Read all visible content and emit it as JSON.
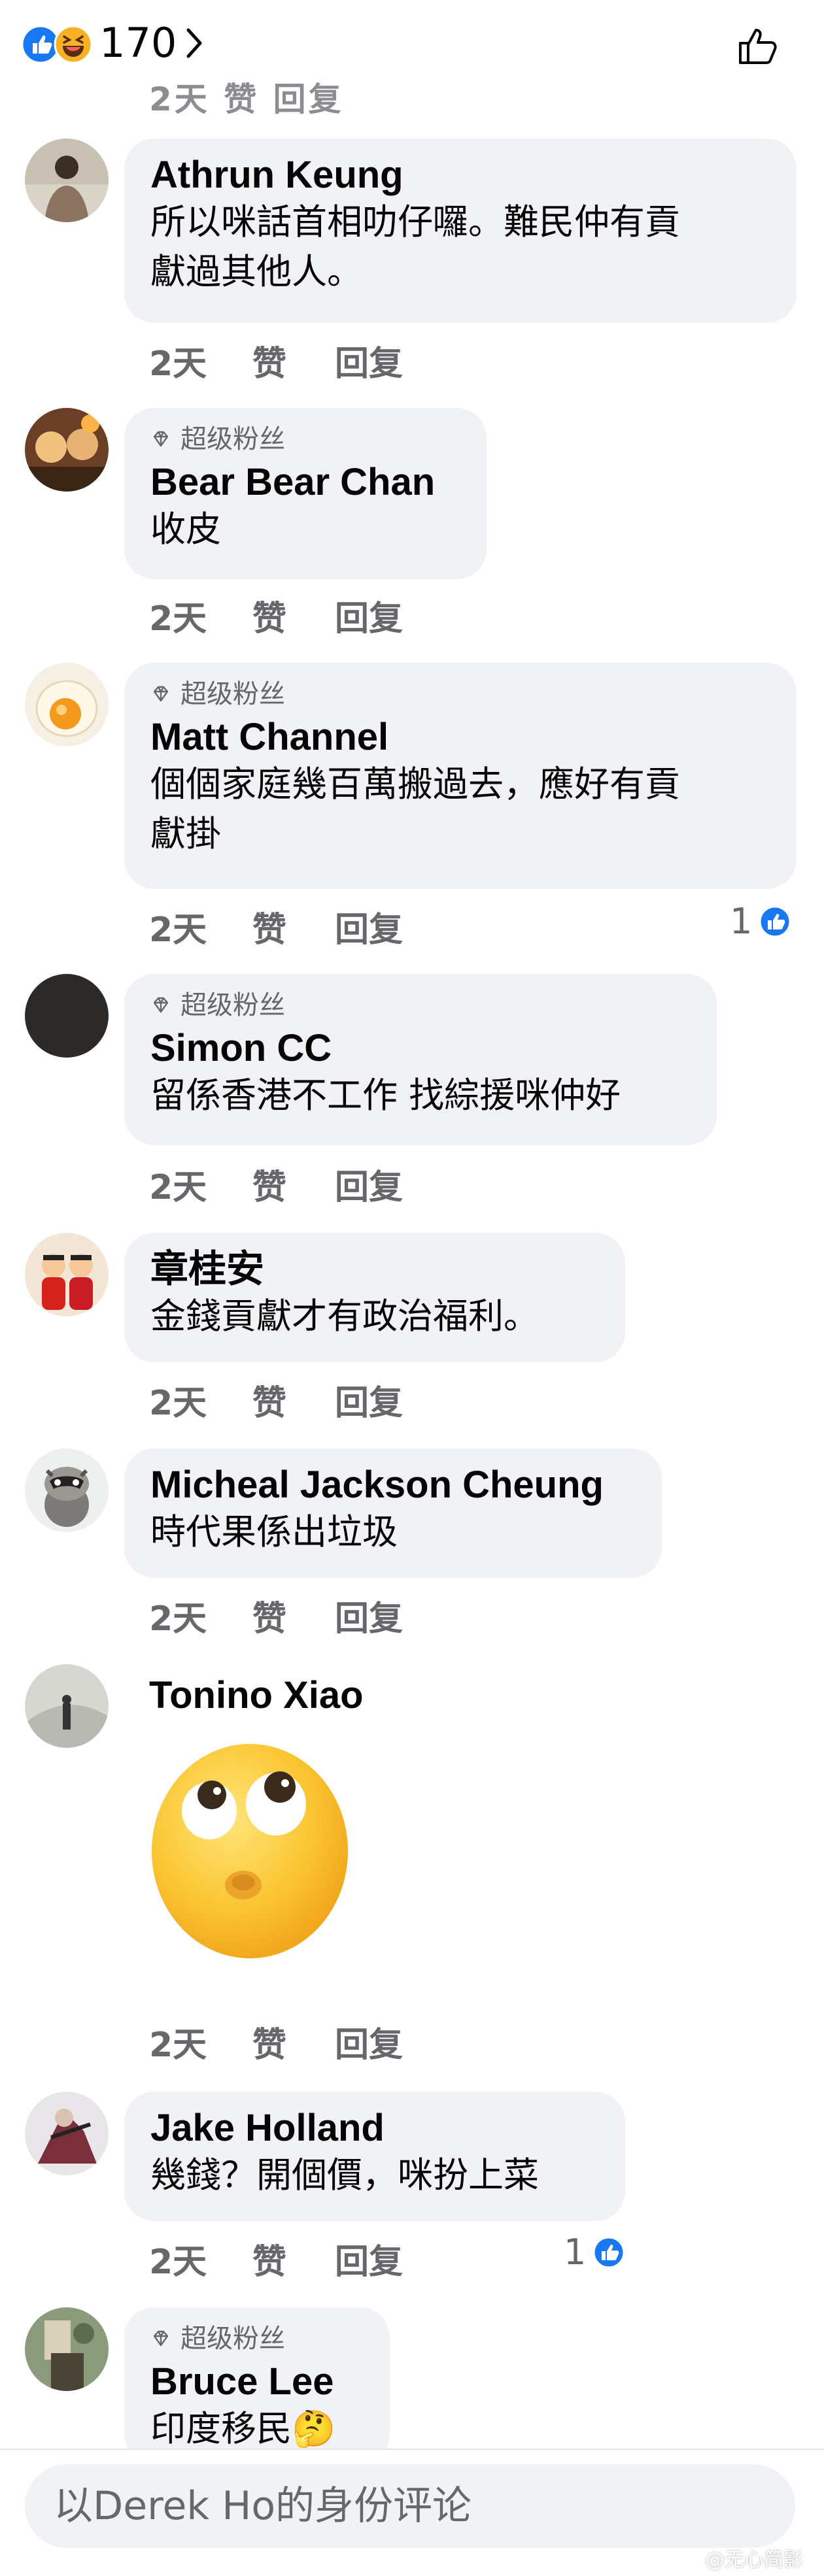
{
  "header": {
    "like_count": "170",
    "reaction_icons": [
      "like-icon",
      "haha-icon"
    ]
  },
  "comments": [
    {
      "name": "Athrun Keung",
      "text": "所以咪話首相叻仔囉。難民仲有貢\n獻過其他人。",
      "time": "2天",
      "like_label": "赞",
      "reply_label": "回复"
    },
    {
      "badge": "超级粉丝",
      "name": "Bear Bear Chan",
      "text": "收皮",
      "time": "2天",
      "like_label": "赞",
      "reply_label": "回复"
    },
    {
      "badge": "超级粉丝",
      "name": "Matt Channel",
      "text": "個個家庭幾百萬搬過去，應好有貢\n獻掛",
      "time": "2天",
      "like_label": "赞",
      "reply_label": "回复",
      "reaction_count": "1"
    },
    {
      "badge": "超级粉丝",
      "name": "Simon CC",
      "text": "留係香港不工作 找綜援咪仲好",
      "time": "2天",
      "like_label": "赞",
      "reply_label": "回复"
    },
    {
      "name": "章桂安",
      "text": "金錢貢獻才有政治福利。",
      "time": "2天",
      "like_label": "赞",
      "reply_label": "回复"
    },
    {
      "name": "Micheal Jackson Cheung",
      "text": "時代果係出垃圾",
      "time": "2天",
      "like_label": "赞",
      "reply_label": "回复"
    },
    {
      "name": "Tonino Xiao",
      "sticker": "eye-roll-emoji-sticker",
      "time": "2天",
      "like_label": "赞",
      "reply_label": "回复"
    },
    {
      "name": "Jake Holland",
      "text": "幾錢？開個價，咪扮上菜",
      "time": "2天",
      "like_label": "赞",
      "reply_label": "回复",
      "reaction_count": "1"
    },
    {
      "badge": "超级粉丝",
      "name": "Bruce Lee",
      "text": "印度移民🤔"
    }
  ],
  "cut_off_actions": "2天   赞   回复",
  "composer": {
    "placeholder": "以Derek Ho的身份评论"
  },
  "watermark": "@无心简影",
  "colors": {
    "bubble": "#f0f2f5",
    "meta_text": "#65676b",
    "like_blue": "#1877f2"
  }
}
